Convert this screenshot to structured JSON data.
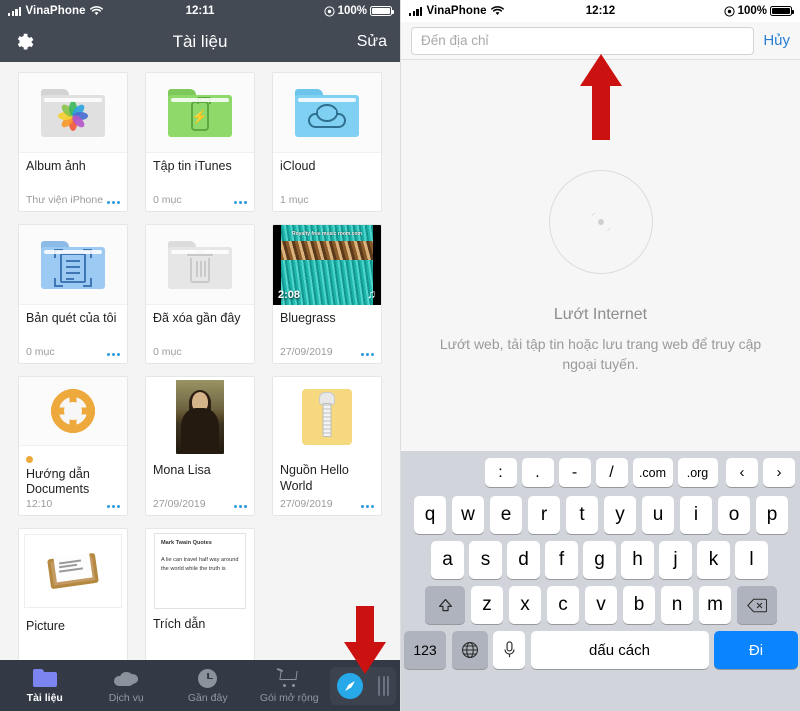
{
  "left_phone": {
    "status_bar": {
      "carrier": "VinaPhone",
      "time": "12:11",
      "battery_pct": "100%",
      "signal_icon": "signal-bars-icon",
      "wifi_icon": "wifi-icon",
      "lock_icon": "rotation-lock-icon"
    },
    "nav_bar": {
      "settings_icon": "gear-icon",
      "title": "Tài liệu",
      "edit_label": "Sửa"
    },
    "files": [
      {
        "name": "Album ảnh",
        "subtitle": "Thư viện iPhone",
        "icon": "photos-folder-icon",
        "has_menu": true,
        "badge": false
      },
      {
        "name": "Tập tin iTunes",
        "subtitle": "0 mục",
        "icon": "itunes-folder-icon",
        "has_menu": true,
        "badge": false
      },
      {
        "name": "iCloud",
        "subtitle": "1 mục",
        "icon": "icloud-folder-icon",
        "has_menu": false,
        "badge": false
      },
      {
        "name": "Bản quét của tôi",
        "subtitle": "0 mục",
        "icon": "scan-folder-icon",
        "has_menu": true,
        "badge": false
      },
      {
        "name": "Đã xóa gần đây",
        "subtitle": "0 mục",
        "icon": "trash-folder-icon",
        "has_menu": false,
        "badge": false
      },
      {
        "name": "Bluegrass",
        "subtitle": "27/09/2019",
        "icon": "video-thumbnail-icon",
        "has_menu": true,
        "badge": false,
        "video_duration": "2:08",
        "video_banner": "Royalty free music room.com"
      },
      {
        "name": "Hướng dẫn Documents",
        "subtitle": "12:10",
        "icon": "lifering-icon",
        "has_menu": true,
        "badge": true
      },
      {
        "name": "Mona Lisa",
        "subtitle": "27/09/2019",
        "icon": "mona-lisa-image-icon",
        "has_menu": true,
        "badge": false
      },
      {
        "name": "Nguồn Hello World",
        "subtitle": "27/09/2019",
        "icon": "zip-archive-icon",
        "has_menu": true,
        "badge": false
      },
      {
        "name": "Picture",
        "subtitle": "",
        "icon": "picture-file-icon",
        "has_menu": false,
        "badge": false
      },
      {
        "name": "Trích dẫn",
        "subtitle": "",
        "icon": "note-preview-icon",
        "has_menu": false,
        "badge": false,
        "note_heading": "Mark Twain Quotes",
        "note_body": "A lie can travel half way around the world while the truth is"
      }
    ],
    "tab_bar": {
      "tabs": [
        {
          "label": "Tài liệu",
          "icon": "folder-icon",
          "active": true
        },
        {
          "label": "Dịch vụ",
          "icon": "cloud-icon",
          "active": false
        },
        {
          "label": "Gần đây",
          "icon": "clock-icon",
          "active": false
        },
        {
          "label": "Gói mở rộng",
          "icon": "cart-icon",
          "active": false
        }
      ],
      "browser_button": {
        "icon": "compass-icon",
        "grip_icon": "drag-handle-icon"
      }
    }
  },
  "right_phone": {
    "status_bar": {
      "carrier": "VinaPhone",
      "time": "12:12",
      "battery_pct": "100%",
      "signal_icon": "signal-bars-icon",
      "wifi_icon": "wifi-icon",
      "lock_icon": "rotation-lock-icon"
    },
    "url_bar": {
      "placeholder": "Đến địa chỉ",
      "value": "",
      "cancel_label": "Hủy"
    },
    "empty_state": {
      "icon": "compass-icon",
      "title": "Lướt Internet",
      "subtitle": "Lướt web, tải tập tin hoặc lưu trang web để truy cập ngoại tuyến."
    },
    "keyboard": {
      "accessory_keys": [
        ":",
        ".",
        "-",
        "/",
        ".com",
        ".org"
      ],
      "prev_label": "‹",
      "next_label": "›",
      "row1": [
        "q",
        "w",
        "e",
        "r",
        "t",
        "y",
        "u",
        "i",
        "o",
        "p"
      ],
      "row2": [
        "a",
        "s",
        "d",
        "f",
        "g",
        "h",
        "j",
        "k",
        "l"
      ],
      "row3": [
        "z",
        "x",
        "c",
        "v",
        "b",
        "n",
        "m"
      ],
      "shift_icon": "shift-icon",
      "backspace_icon": "backspace-icon",
      "numbers_label": "123",
      "globe_icon": "globe-icon",
      "mic_icon": "microphone-icon",
      "space_label": "dấu cách",
      "go_label": "Đi"
    }
  },
  "annotations": {
    "arrow_up": "red-up-arrow",
    "arrow_down": "red-down-arrow",
    "color": "#cc1111"
  }
}
